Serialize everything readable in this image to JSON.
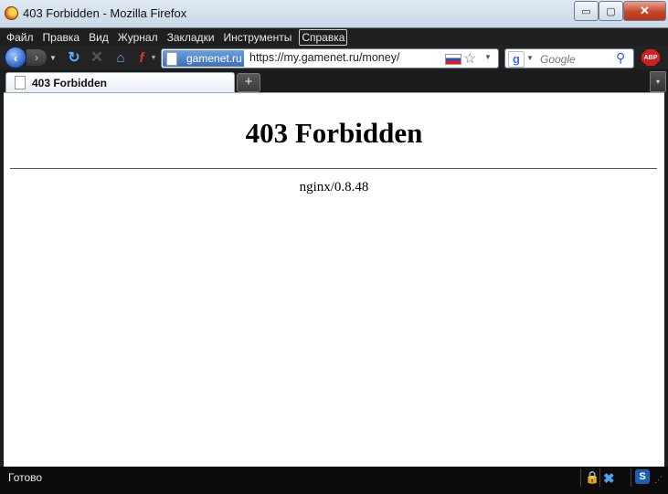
{
  "window": {
    "title": "403 Forbidden - Mozilla Firefox",
    "controls": {
      "minimize": "▭",
      "maximize": "▢",
      "close": "✕"
    }
  },
  "menu": [
    "Файл",
    "Правка",
    "Вид",
    "Журнал",
    "Закладки",
    "Инструменты",
    "Справка"
  ],
  "nav": {
    "back_icon": "‹",
    "forward_icon": "›",
    "reload_icon": "↻",
    "stop_icon": "✕",
    "home_icon": "⌂",
    "flash_icon": "f",
    "site_identity": "gamenet.ru",
    "url": "https://my.gamenet.ru/money/",
    "star_icon": "☆",
    "search_placeholder": "Google",
    "search_go_icon": "⚲",
    "search_engine_icon": "g",
    "abp_label": "ABP"
  },
  "tabs": {
    "active_label": "403 Forbidden",
    "new_tab_icon": "+",
    "list_icon": "▾"
  },
  "page": {
    "heading": "403 Forbidden",
    "server": "nginx/0.8.48"
  },
  "status": {
    "text": "Готово",
    "lock_icon": "🔒",
    "x_icon": "✖",
    "s_icon": "S"
  },
  "colors": {
    "accent": "#3d6fb8",
    "chrome_dark": "#1f1f1f"
  }
}
